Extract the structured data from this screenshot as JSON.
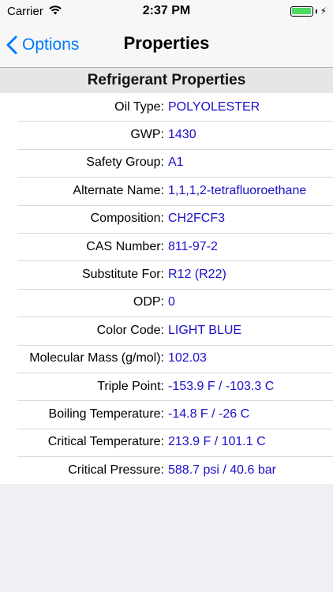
{
  "status_bar": {
    "carrier": "Carrier",
    "time": "2:37 PM",
    "battery_color": "#4cd964"
  },
  "nav": {
    "back_label": "Options",
    "title": "Properties",
    "accent_color": "#007aff"
  },
  "section": {
    "title": "Refrigerant Properties"
  },
  "properties": [
    {
      "label": "Oil Type:",
      "value": "POLYOLESTER"
    },
    {
      "label": "GWP:",
      "value": "1430"
    },
    {
      "label": "Safety Group:",
      "value": "A1"
    },
    {
      "label": "Alternate Name:",
      "value": "1,1,1,2-tetrafluoroethane"
    },
    {
      "label": "Composition:",
      "value": "CH2FCF3"
    },
    {
      "label": "CAS Number:",
      "value": "811-97-2"
    },
    {
      "label": "Substitute For:",
      "value": "R12 (R22)"
    },
    {
      "label": "ODP:",
      "value": "0"
    },
    {
      "label": "Color Code:",
      "value": "LIGHT BLUE"
    },
    {
      "label": "Molecular Mass (g/mol):",
      "value": "102.03"
    },
    {
      "label": "Triple Point:",
      "value": "-153.9 F / -103.3 C"
    },
    {
      "label": "Boiling Temperature:",
      "value": "-14.8 F / -26 C"
    },
    {
      "label": "Critical Temperature:",
      "value": "213.9 F / 101.1 C"
    },
    {
      "label": "Critical Pressure:",
      "value": "588.7 psi / 40.6 bar"
    }
  ]
}
